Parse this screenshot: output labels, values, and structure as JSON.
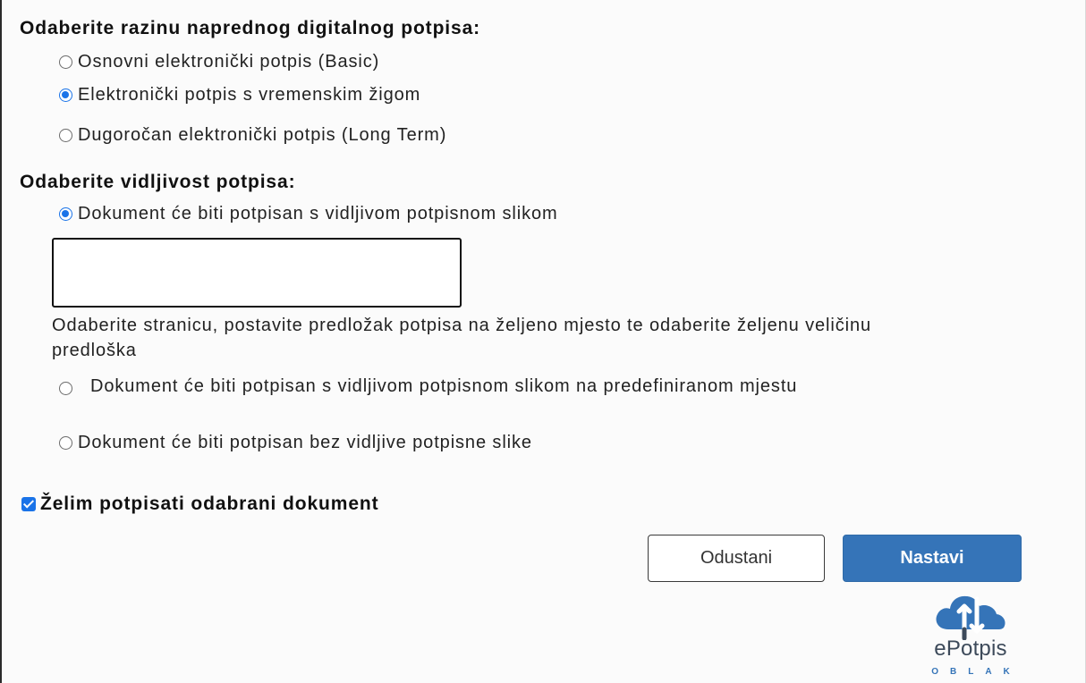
{
  "signature_level": {
    "heading": "Odaberite razinu naprednog digitalnog potpisa:",
    "options": [
      {
        "label": "Osnovni elektronički potpis (Basic)",
        "selected": false
      },
      {
        "label": "Elektronički potpis s vremenskim žigom",
        "selected": true
      },
      {
        "label": "Dugoročan elektronički potpis (Long Term)",
        "selected": false
      }
    ]
  },
  "visibility": {
    "heading": "Odaberite vidljivost potpisa:",
    "option_visible": {
      "label": "Dokument će biti potpisan s vidljivom potpisnom slikom",
      "selected": true
    },
    "instruction": "Odaberite stranicu, postavite predložak potpisa na željeno mjesto te odaberite željenu veličinu predloška",
    "option_predefined": {
      "label": "Dokument će biti potpisan s vidljivom potpisnom slikom na predefiniranom mjestu",
      "selected": false
    },
    "option_invisible": {
      "label": "Dokument će biti potpisan bez vidljive potpisne slike",
      "selected": false
    }
  },
  "confirm": {
    "label": "Želim potpisati odabrani dokument",
    "checked": true
  },
  "buttons": {
    "cancel": "Odustani",
    "continue": "Nastavi"
  },
  "logo": {
    "name": "ePotpis",
    "sub": "OBLAK",
    "icon": "cloud-arrows-icon"
  },
  "colors": {
    "accent": "#1a73e8",
    "primary_button": "#3574b8"
  }
}
